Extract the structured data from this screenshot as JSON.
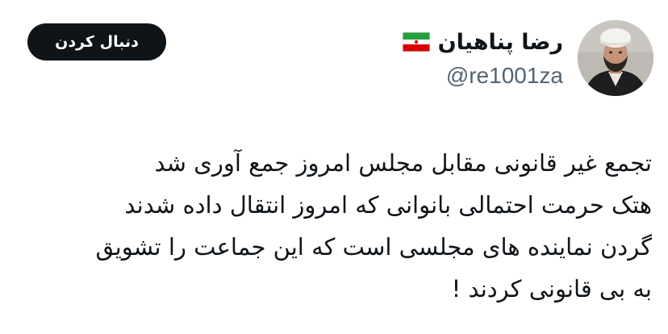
{
  "author": {
    "display_name": "رضا پناهیان",
    "handle": "@re1001za",
    "flag_icon": "iran-flag-icon",
    "avatar_icon": "profile-photo"
  },
  "follow_button": {
    "label": "دنبال کردن"
  },
  "tweet": {
    "lines": [
      "تجمع غیر قانونی مقابل مجلس امروز جمع آوری شد",
      "هتک حرمت احتمالی بانوانی که امروز انتقال داده شدند",
      "گردن نماینده های مجلسی است که این جماعت را تشویق",
      "به بی قانونی کردند !"
    ]
  },
  "colors": {
    "text_primary": "#0f1419",
    "text_secondary": "#536471",
    "button_bg": "#0f1419",
    "button_text": "#ffffff",
    "background": "#ffffff"
  }
}
